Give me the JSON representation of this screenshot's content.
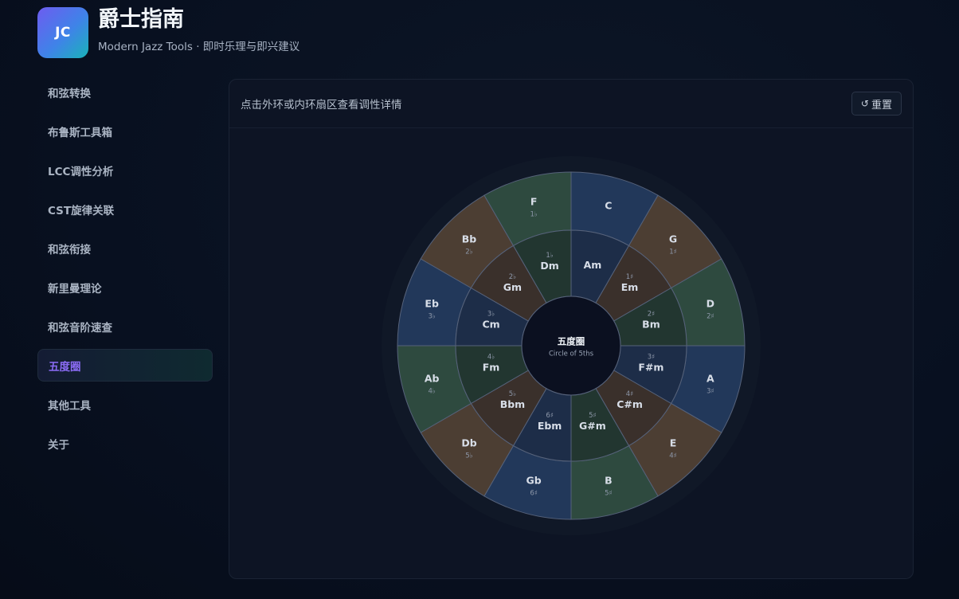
{
  "app": {
    "logo_text": "JC",
    "title": "爵士指南",
    "subtitle": "Modern Jazz Tools · 即时乐理与即兴建议"
  },
  "sidebar": {
    "items": [
      {
        "label": "和弦转换"
      },
      {
        "label": "布鲁斯工具箱"
      },
      {
        "label": "LCC调性分析"
      },
      {
        "label": "CST旋律关联"
      },
      {
        "label": "和弦衔接"
      },
      {
        "label": "新里曼理论"
      },
      {
        "label": "和弦音阶速查"
      },
      {
        "label": "五度圈",
        "active": true
      },
      {
        "label": "其他工具"
      },
      {
        "label": "关于"
      }
    ]
  },
  "panel": {
    "hint": "点击外环或内环扇区查看调性详情",
    "reset_label": "重置",
    "reset_icon": "refresh-icon"
  },
  "circle": {
    "center_title": "五度圈",
    "center_subtitle": "Circle of 5ths",
    "colors": {
      "blue": "#22385a",
      "green": "#2e4a3f",
      "brown": "#4c3e33",
      "inner_blue": "#1d2d48",
      "inner_green": "#223630",
      "inner_brown": "#3a302b",
      "center": "#0b1020",
      "ring_bg": "#101827",
      "line": "#56627a"
    },
    "keys": [
      {
        "major": "C",
        "minor": "Am",
        "sig": "",
        "tone": "blue"
      },
      {
        "major": "G",
        "minor": "Em",
        "sig": "1♯",
        "tone": "brown"
      },
      {
        "major": "D",
        "minor": "Bm",
        "sig": "2♯",
        "tone": "green"
      },
      {
        "major": "A",
        "minor": "F#m",
        "sig": "3♯",
        "tone": "blue"
      },
      {
        "major": "E",
        "minor": "C#m",
        "sig": "4♯",
        "tone": "brown"
      },
      {
        "major": "B",
        "minor": "G#m",
        "sig": "5♯",
        "tone": "green"
      },
      {
        "major": "Gb",
        "minor": "Ebm",
        "sig": "6♯",
        "tone": "blue"
      },
      {
        "major": "Db",
        "minor": "Bbm",
        "sig": "5♭",
        "tone": "brown"
      },
      {
        "major": "Ab",
        "minor": "Fm",
        "sig": "4♭",
        "tone": "green"
      },
      {
        "major": "Eb",
        "minor": "Cm",
        "sig": "3♭",
        "tone": "blue"
      },
      {
        "major": "Bb",
        "minor": "Gm",
        "sig": "2♭",
        "tone": "brown"
      },
      {
        "major": "F",
        "minor": "Dm",
        "sig": "1♭",
        "tone": "green"
      }
    ]
  }
}
